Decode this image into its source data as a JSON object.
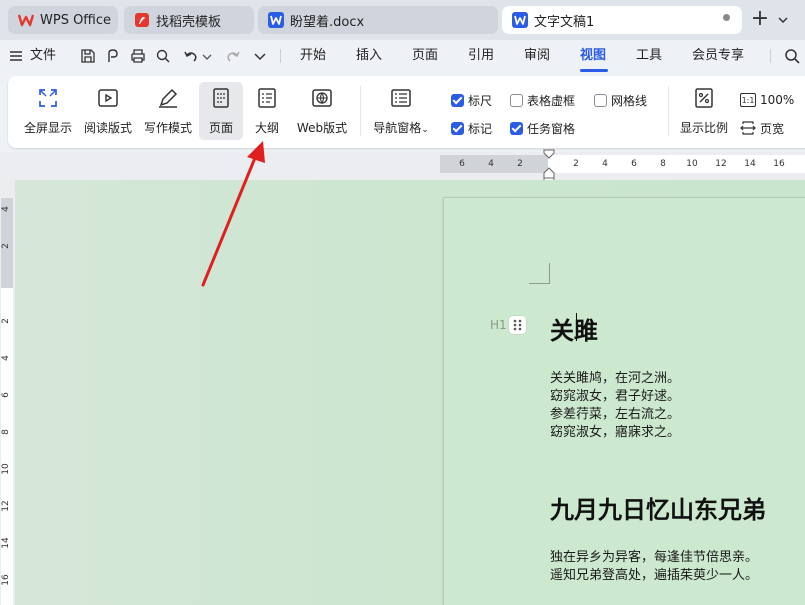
{
  "tabs": [
    {
      "label": "WPS Office",
      "icon": "wps-logo-icon",
      "state": "inactive"
    },
    {
      "label": "找稻壳模板",
      "icon": "docer-icon",
      "state": "inactive"
    },
    {
      "label": "盼望着.docx",
      "icon": "word-doc-icon",
      "state": "inactive"
    },
    {
      "label": "文字文稿1",
      "icon": "word-doc-icon",
      "state": "active"
    }
  ],
  "menu": {
    "file": "文件",
    "items": [
      "开始",
      "插入",
      "页面",
      "引用",
      "审阅",
      "视图",
      "工具",
      "会员专享"
    ],
    "active": "视图"
  },
  "ribbon": {
    "view_buttons": [
      {
        "label": "全屏显示",
        "icon": "fullscreen-icon"
      },
      {
        "label": "阅读版式",
        "icon": "reading-mode-icon"
      },
      {
        "label": "写作模式",
        "icon": "writing-mode-icon"
      },
      {
        "label": "页面",
        "icon": "page-view-icon",
        "selected": true
      },
      {
        "label": "大纲",
        "icon": "outline-icon"
      },
      {
        "label": "Web版式",
        "icon": "web-layout-icon"
      }
    ],
    "nav_pane": {
      "label": "导航窗格",
      "icon": "navigation-pane-icon"
    },
    "checkboxes": [
      {
        "label": "标尺",
        "checked": true
      },
      {
        "label": "表格虚框",
        "checked": false
      },
      {
        "label": "网格线",
        "checked": false
      },
      {
        "label": "标记",
        "checked": true
      },
      {
        "label": "任务窗格",
        "checked": true
      }
    ],
    "zoom": {
      "label": "显示比例",
      "icon": "zoom-percent-icon"
    },
    "zoom100": {
      "label": "100%",
      "icon": "one-to-one-icon"
    },
    "page_width": {
      "label": "页宽",
      "icon": "page-width-icon"
    }
  },
  "hruler_numbers": [
    "6",
    "4",
    "2",
    "2",
    "4",
    "6",
    "8",
    "10",
    "12",
    "14",
    "16"
  ],
  "vruler_numbers": [
    "4",
    "2",
    "2",
    "4",
    "6",
    "8",
    "10",
    "12",
    "14",
    "16"
  ],
  "document": {
    "heading_style_tag": "H1",
    "title1": "关雎",
    "poem1": [
      "关关雎鸠，在河之洲。",
      "窈窕淑女，君子好逑。",
      "参差荇菜，左右流之。",
      "窈窕淑女，寤寐求之。"
    ],
    "title2": "九月九日忆山东兄弟",
    "poem2": [
      "独在异乡为异客，每逢佳节倍思亲。",
      "遥知兄弟登高处，遍插茱萸少一人。"
    ]
  },
  "colors": {
    "accent": "#2b5ce6",
    "doc_background": "#cce8cf",
    "arrow": "#e02020"
  }
}
